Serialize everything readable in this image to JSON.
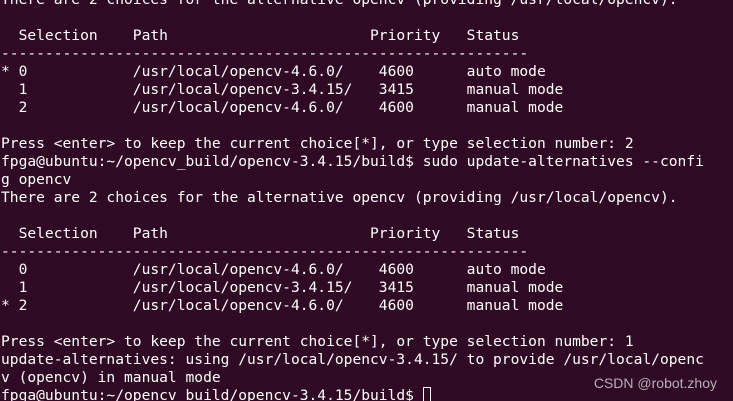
{
  "terminal": {
    "lines": [
      "There are 2 choices for the alternative opencv (providing /usr/local/opencv).",
      "",
      "  Selection    Path                       Priority   Status",
      "------------------------------------------------------------",
      "* 0            /usr/local/opencv-4.6.0/    4600      auto mode",
      "  1            /usr/local/opencv-3.4.15/   3415      manual mode",
      "  2            /usr/local/opencv-4.6.0/    4600      manual mode",
      "",
      "Press <enter> to keep the current choice[*], or type selection number: 2",
      "fpga@ubuntu:~/opencv_build/opencv-3.4.15/build$ sudo update-alternatives --confi",
      "g opencv",
      "There are 2 choices for the alternative opencv (providing /usr/local/opencv).",
      "",
      "  Selection    Path                       Priority   Status",
      "------------------------------------------------------------",
      "  0            /usr/local/opencv-4.6.0/    4600      auto mode",
      "  1            /usr/local/opencv-3.4.15/   3415      manual mode",
      "* 2            /usr/local/opencv-4.6.0/    4600      manual mode",
      "",
      "Press <enter> to keep the current choice[*], or type selection number: 1",
      "update-alternatives: using /usr/local/opencv-3.4.15/ to provide /usr/local/openc",
      "v (opencv) in manual mode",
      "fpga@ubuntu:~/opencv_build/opencv-3.4.15/build$ "
    ],
    "watermark": "CSDN @robot.zhoy",
    "colors": {
      "background": "#300a24",
      "foreground": "#ffffff"
    }
  }
}
